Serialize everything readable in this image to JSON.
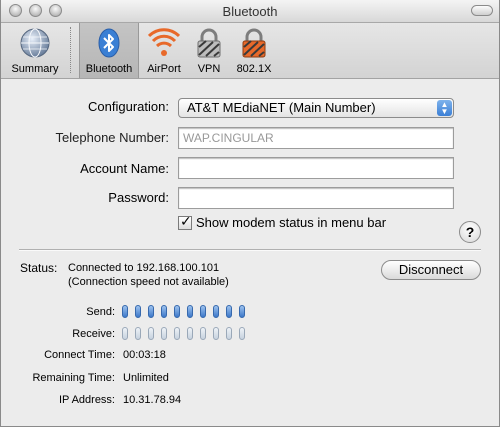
{
  "window": {
    "title": "Bluetooth"
  },
  "toolbar": {
    "items": [
      {
        "label": "Summary",
        "icon": "globe-icon"
      },
      {
        "label": "Bluetooth",
        "icon": "bluetooth-icon",
        "selected": true
      },
      {
        "label": "AirPort",
        "icon": "airport-icon"
      },
      {
        "label": "VPN",
        "icon": "lock-icon"
      },
      {
        "label": "802.1X",
        "icon": "lock-orange-icon"
      }
    ]
  },
  "form": {
    "configuration_label": "Configuration:",
    "configuration_value": "AT&T MEdiaNET (Main Number)",
    "telephone_label": "Telephone Number:",
    "telephone_placeholder": "WAP.CINGULAR",
    "account_label": "Account Name:",
    "account_value": "",
    "password_label": "Password:",
    "password_value": "",
    "show_modem_label": "Show modem status in menu bar",
    "show_modem_checked": true
  },
  "status": {
    "label": "Status:",
    "line1": "Connected to 192.168.100.101",
    "line2": "(Connection speed not available)",
    "disconnect_label": "Disconnect",
    "send_label": "Send:",
    "receive_label": "Receive:",
    "send_level": 1.0,
    "receive_level": 0.0,
    "bar_count": 10,
    "connect_time_label": "Connect Time:",
    "connect_time": "00:03:18",
    "remaining_label": "Remaining Time:",
    "remaining_value": "Unlimited",
    "ip_label": "IP Address:",
    "ip_value": "10.31.78.94"
  },
  "colors": {
    "accent": "#3b7fd6",
    "bar_on": "#3d78c9",
    "airport": "#e8692a"
  }
}
